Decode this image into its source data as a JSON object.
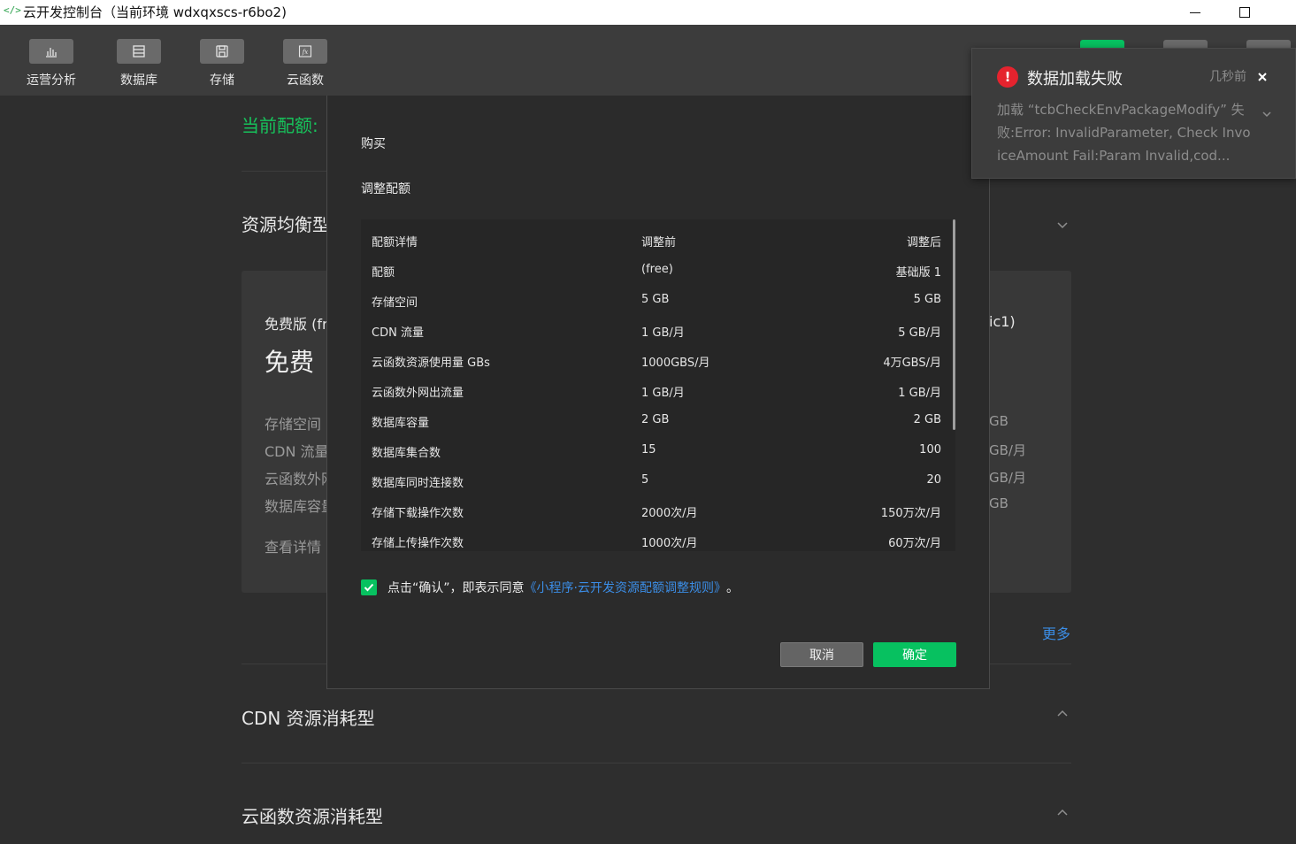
{
  "window": {
    "app_icon": "</>",
    "title": "云开发控制台（当前环境 wdxqxscs-r6bo2)"
  },
  "toolbar": {
    "items": [
      {
        "label": "运营分析",
        "icon": "bar-chart-icon"
      },
      {
        "label": "数据库",
        "icon": "database-icon"
      },
      {
        "label": "存储",
        "icon": "storage-icon"
      },
      {
        "label": "云函数",
        "icon": "function-icon"
      }
    ],
    "colors": {
      "accent": "#07c160"
    }
  },
  "background": {
    "quota_label": "当前配额:",
    "section_resource_balanced": "资源均衡型",
    "card_left": {
      "name": "免费版 (fr",
      "price": "免费",
      "features": [
        "存储空间",
        "CDN 流量",
        "云函数外网",
        "数据库容量"
      ],
      "detail_link": "查看详情"
    },
    "card_right": {
      "name": "ic1)",
      "features": [
        "GB",
        "GB/月",
        "GB/月",
        "GB"
      ]
    },
    "more_link": "更多",
    "section_cdn": "CDN 资源消耗型",
    "section_scf": "云函数资源消耗型"
  },
  "dialog": {
    "title": "购买",
    "subtitle": "调整配额",
    "table": {
      "headers": [
        "配额详情",
        "调整前",
        "调整后"
      ],
      "rows": [
        [
          "配额",
          "(free)",
          "基础版 1"
        ],
        [
          "存储空间",
          "5 GB",
          "5 GB"
        ],
        [
          "CDN 流量",
          "1 GB/月",
          "5 GB/月"
        ],
        [
          "云函数资源使用量 GBs",
          "1000GBS/月",
          "4万GBS/月"
        ],
        [
          "云函数外网出流量",
          "1 GB/月",
          "1 GB/月"
        ],
        [
          "数据库容量",
          "2 GB",
          "2 GB"
        ],
        [
          "数据库集合数",
          "15",
          "100"
        ],
        [
          "数据库同时连接数",
          "5",
          "20"
        ],
        [
          "存储下载操作次数",
          "2000次/月",
          "150万次/月"
        ],
        [
          "存储上传操作次数",
          "1000次/月",
          "60万次/月"
        ]
      ]
    },
    "agreement": {
      "checked": true,
      "text": "点击“确认”，即表示同意",
      "link": "《小程序·云开发资源配额调整规则》",
      "end": "。"
    },
    "cancel_label": "取消",
    "ok_label": "确定"
  },
  "toast": {
    "icon": "!",
    "title": "数据加载失败",
    "time": "几秒前",
    "message": "加载 “tcbCheckEnvPackageModify” 失败:Error: InvalidParameter, Check InvoiceAmount Fail:Param Invalid,cod..."
  }
}
